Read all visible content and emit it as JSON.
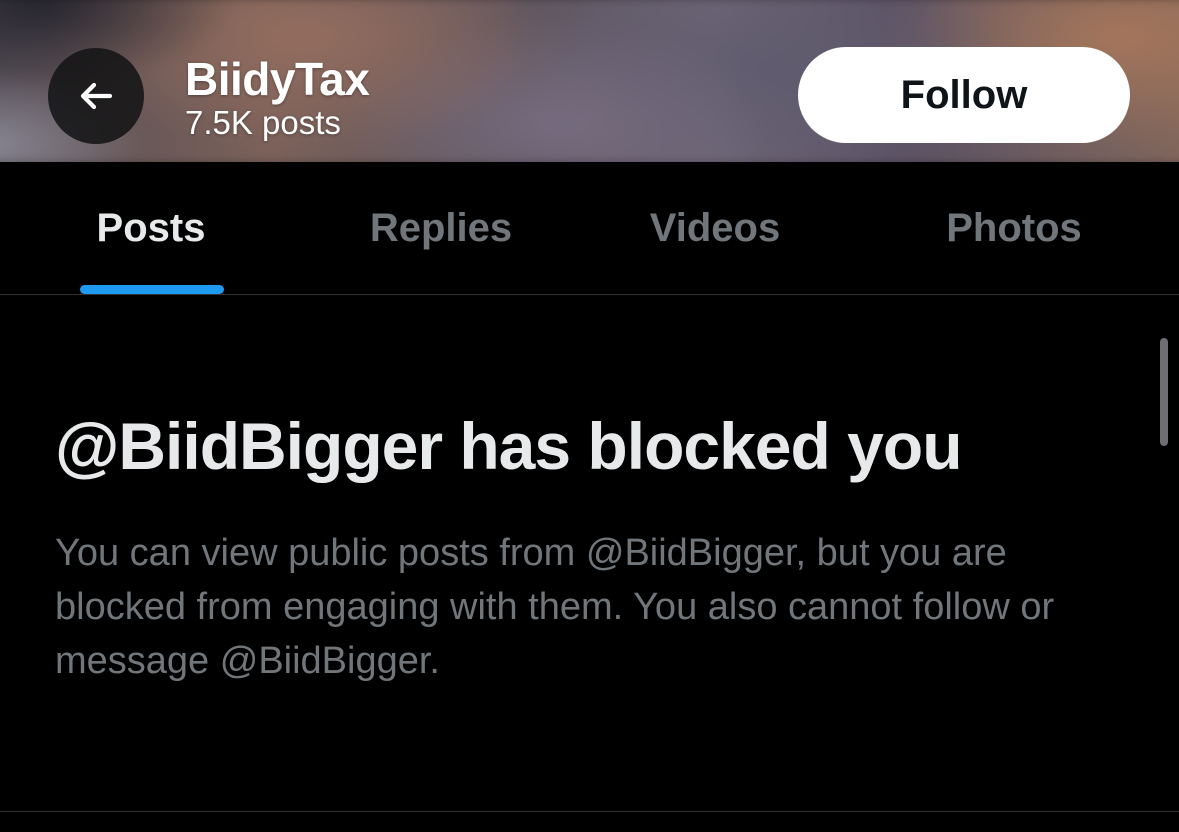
{
  "header": {
    "profile_name": "BiidyTax",
    "post_count": "7.5K posts",
    "back_icon": "arrow-left-icon",
    "follow_label": "Follow"
  },
  "tabs": [
    {
      "label": "Posts",
      "active": true
    },
    {
      "label": "Replies",
      "active": false
    },
    {
      "label": "Videos",
      "active": false
    },
    {
      "label": "Photos",
      "active": false
    }
  ],
  "blocked": {
    "title": "@BiidBigger has blocked you",
    "description": "You can view public posts from @BiidBigger, but you are blocked from engaging with them. You also cannot follow or message @BiidBigger."
  },
  "colors": {
    "background": "#000000",
    "accent": "#1d9bf0",
    "primary_text": "#e7e9ea",
    "secondary_text": "#71767b",
    "follow_button_bg": "#ffffff",
    "divider": "#2f3336"
  }
}
